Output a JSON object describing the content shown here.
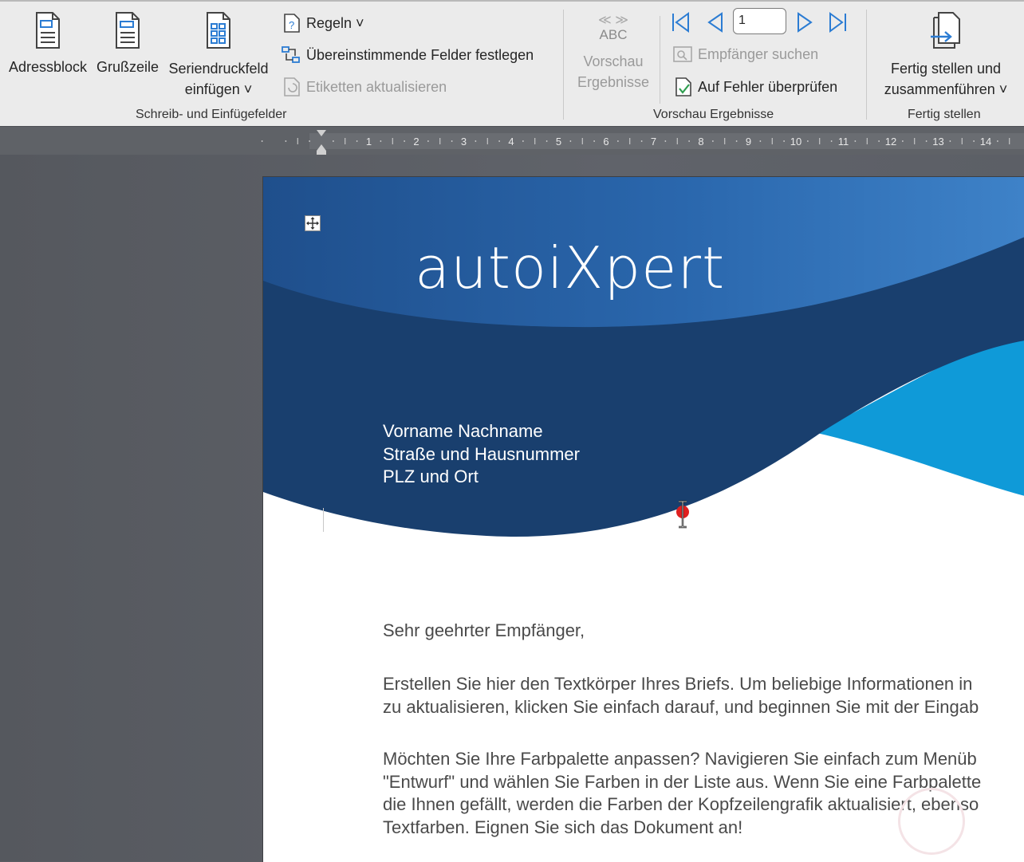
{
  "ribbon": {
    "adressblock": "Adressblock",
    "grusszeile": "Grußzeile",
    "seriendruckfeld_line1": "Seriendruckfeld",
    "seriendruckfeld_line2": "einfügen ˅",
    "regeln": "Regeln ˅",
    "uebereinstimmende": "Übereinstimmende Felder festlegen",
    "etiketten": "Etiketten aktualisieren",
    "group1_label": "Schreib- und Einfügefelder",
    "abc_arrows": "≪ ≫",
    "abc": "ABC",
    "vorschau_line1": "Vorschau",
    "vorschau_line2": "Ergebnisse",
    "record_number": "1",
    "empfaenger_suchen": "Empfänger suchen",
    "auf_fehler": "Auf Fehler überprüfen",
    "group2_label": "Vorschau Ergebnisse",
    "fertig_line1": "Fertig stellen und",
    "fertig_line2": "zusammenführen ˅",
    "group3_label": "Fertig stellen"
  },
  "ruler": {
    "ticks": [
      "1",
      "2",
      "3",
      "4",
      "5",
      "6",
      "7",
      "8",
      "9",
      "10",
      "11",
      "12",
      "13",
      "14"
    ]
  },
  "document": {
    "logo": "autoiXpert",
    "address": [
      "Vorname Nachname",
      "Straße und Hausnummer",
      "PLZ und Ort"
    ],
    "salutation": "Sehr geehrter Empfänger,",
    "para1": [
      "Erstellen Sie hier den Textkörper Ihres Briefs. Um beliebige Informationen in",
      "zu aktualisieren, klicken Sie einfach darauf, und beginnen Sie mit der Eingab"
    ],
    "para2": [
      "Möchten Sie Ihre Farbpalette anpassen? Navigieren Sie einfach zum Menüb",
      "\"Entwurf\" und wählen Sie Farben in der Liste aus. Wenn Sie eine Farbpalette",
      "die Ihnen gefällt, werden die Farben der Kopfzeilengrafik aktualisiert, ebenso",
      "Textfarben. Eignen Sie sich das Dokument an!"
    ]
  },
  "colors": {
    "navy": "#193f6e",
    "mid_blue": "#2b6cb0",
    "light_blue": "#0f9ad8",
    "accent": "#2b7cd3"
  }
}
